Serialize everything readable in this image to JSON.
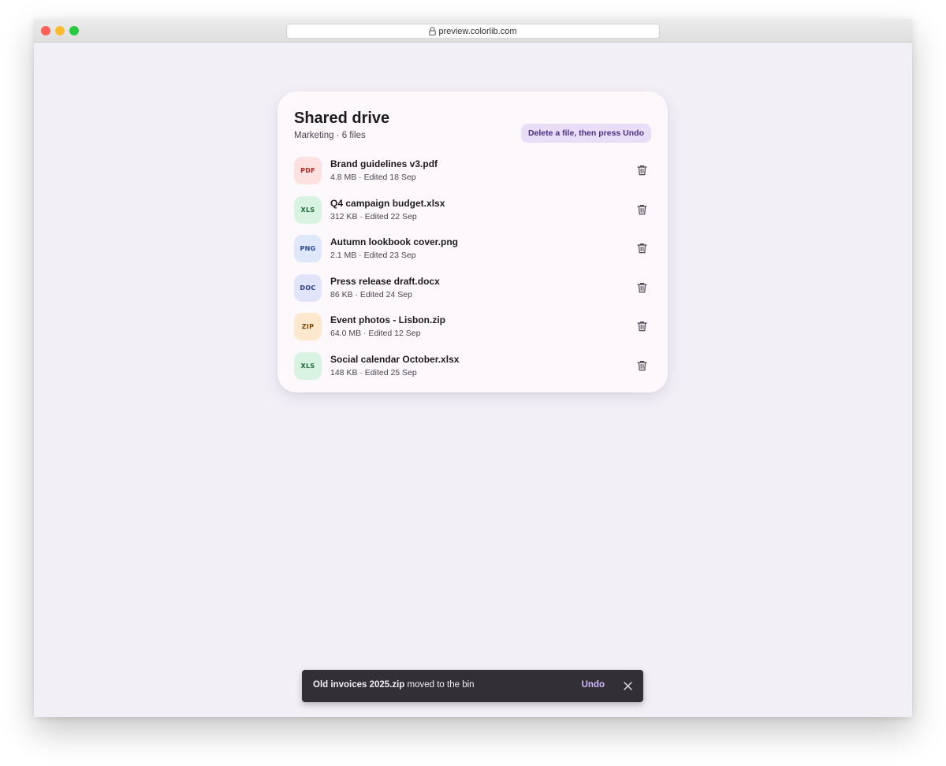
{
  "browser": {
    "url": "preview.colorlib.com"
  },
  "drive": {
    "title": "Shared drive",
    "subtitle": "Marketing · 6 files",
    "hint": "Delete a file, then press Undo",
    "files": [
      {
        "type": "PDF",
        "name": "Brand guidelines v3.pdf",
        "meta": "4.8 MB · Edited 18 Sep",
        "badge_bg": "#fde0e0",
        "badge_fg": "#b3261e"
      },
      {
        "type": "XLS",
        "name": "Q4 campaign budget.xlsx",
        "meta": "312 KB · Edited 22 Sep",
        "badge_bg": "#d8f3e2",
        "badge_fg": "#1b6b3a"
      },
      {
        "type": "PNG",
        "name": "Autumn lookbook cover.png",
        "meta": "2.1 MB · Edited 23 Sep",
        "badge_bg": "#dfe7fb",
        "badge_fg": "#2a4a9a"
      },
      {
        "type": "DOC",
        "name": "Press release draft.docx",
        "meta": "86 KB · Edited 24 Sep",
        "badge_bg": "#e2e5fa",
        "badge_fg": "#2c3a86"
      },
      {
        "type": "ZIP",
        "name": "Event photos - Lisbon.zip",
        "meta": "64.0 MB · Edited 12 Sep",
        "badge_bg": "#fde8cd",
        "badge_fg": "#7a4a06"
      },
      {
        "type": "XLS",
        "name": "Social calendar October.xlsx",
        "meta": "148 KB · Edited 25 Sep",
        "badge_bg": "#d8f3e2",
        "badge_fg": "#1b6b3a"
      }
    ]
  },
  "snackbar": {
    "filename": "Old invoices 2025.zip",
    "message": " moved to the bin",
    "action": "Undo"
  },
  "icons": {
    "delete": "trash-icon",
    "close": "close-icon",
    "lock": "lock-icon"
  }
}
